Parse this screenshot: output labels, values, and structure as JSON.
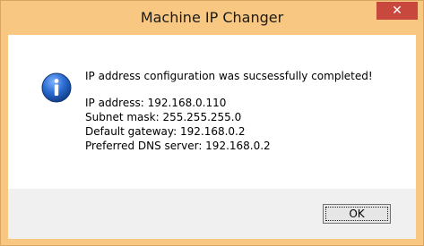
{
  "window": {
    "title": "Machine IP Changer",
    "close_glyph": "✕"
  },
  "dialog": {
    "icon": "info-icon",
    "headline": "IP address configuration was sucsessfully completed!",
    "details": [
      "IP address: 192.168.0.110",
      "Subnet mask: 255.255.255.0",
      "Default gateway: 192.168.0.2",
      "Preferred DNS server: 192.168.0.2"
    ],
    "ok_label": "OK"
  },
  "colors": {
    "titlebar": "#f8c882",
    "close_button": "#c9483d",
    "icon_blue": "#1f5fbf"
  }
}
